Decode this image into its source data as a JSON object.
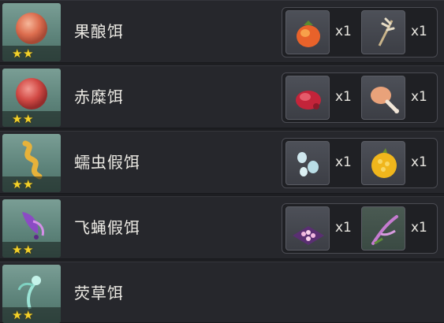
{
  "stars_glyph": "★",
  "rows": [
    {
      "name": "果酿饵",
      "icon": "peach-orb-icon",
      "stars": 2,
      "ingredients": [
        {
          "icon": "sunsettia-fruit-icon",
          "qty": "x1"
        },
        {
          "icon": "feather-twig-icon",
          "qty": "x1"
        }
      ]
    },
    {
      "name": "赤糜饵",
      "icon": "red-orb-icon",
      "stars": 2,
      "ingredients": [
        {
          "icon": "raw-meat-icon",
          "qty": "x1"
        },
        {
          "icon": "fowl-leg-icon",
          "qty": "x1"
        }
      ]
    },
    {
      "name": "蠕虫假饵",
      "icon": "worm-lure-icon",
      "stars": 2,
      "ingredients": [
        {
          "icon": "crystal-drops-icon",
          "qty": "x1"
        },
        {
          "icon": "golden-fruit-icon",
          "qty": "x1"
        }
      ]
    },
    {
      "name": "飞蝇假饵",
      "icon": "fly-lure-icon",
      "stars": 2,
      "ingredients": [
        {
          "icon": "pink-flower-bed-icon",
          "qty": "x1"
        },
        {
          "icon": "feather-plant-icon",
          "qty": "x1"
        }
      ]
    },
    {
      "name": "荧草饵",
      "icon": "glowing-grass-lure-icon",
      "stars": 2,
      "ingredients": []
    }
  ]
}
